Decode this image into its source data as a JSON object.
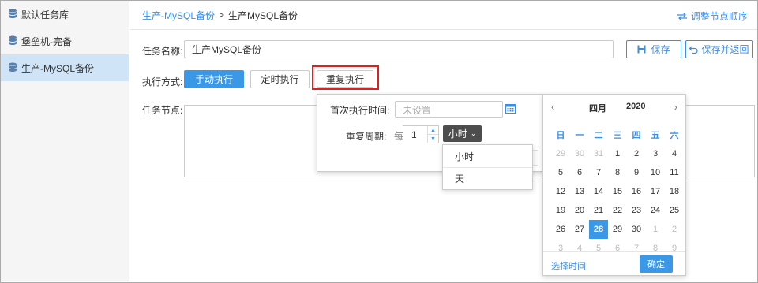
{
  "sidebar": {
    "items": [
      {
        "label": "默认任务库"
      },
      {
        "label": "堡垒机-完备"
      },
      {
        "label": "生产-MySQL备份"
      }
    ]
  },
  "header": {
    "breadcrumb_parent": "生产-MySQL备份",
    "breadcrumb_sep": ">",
    "breadcrumb_current": "生产MySQL备份",
    "reorder_label": "调整节点顺序"
  },
  "form": {
    "task_name_label": "任务名称:",
    "task_name_value": "生产MySQL备份",
    "save_label": "保存",
    "save_return_label": "保存并返回",
    "exec_mode_label": "执行方式:",
    "exec_modes": [
      "手动执行",
      "定时执行",
      "重复执行"
    ],
    "task_nodes_label": "任务节点:"
  },
  "repeat_popup": {
    "first_exec_label": "首次执行时间:",
    "first_exec_placeholder": "未设置",
    "period_label": "重复周期:",
    "every_label": "每",
    "period_value": "1",
    "unit_selected": "小时",
    "unit_options": [
      "小时",
      "天"
    ]
  },
  "calendar": {
    "prev": "‹",
    "next": "›",
    "month": "四月",
    "year": "2020",
    "weekdays": [
      "日",
      "一",
      "二",
      "三",
      "四",
      "五",
      "六"
    ],
    "days": [
      [
        "29",
        "30",
        "31",
        "1",
        "2",
        "3",
        "4"
      ],
      [
        "5",
        "6",
        "7",
        "8",
        "9",
        "10",
        "11"
      ],
      [
        "12",
        "13",
        "14",
        "15",
        "16",
        "17",
        "18"
      ],
      [
        "19",
        "20",
        "21",
        "22",
        "23",
        "24",
        "25"
      ],
      [
        "26",
        "27",
        "28",
        "29",
        "30",
        "1",
        "2"
      ],
      [
        "3",
        "4",
        "5",
        "6",
        "7",
        "8",
        "9"
      ]
    ],
    "selected_day": "28",
    "pick_time_label": "选择时间",
    "confirm_label": "确定"
  },
  "colors": {
    "accent": "#3a98e6",
    "highlight": "#e02020",
    "sidebar_active": "#cfe5f7"
  }
}
